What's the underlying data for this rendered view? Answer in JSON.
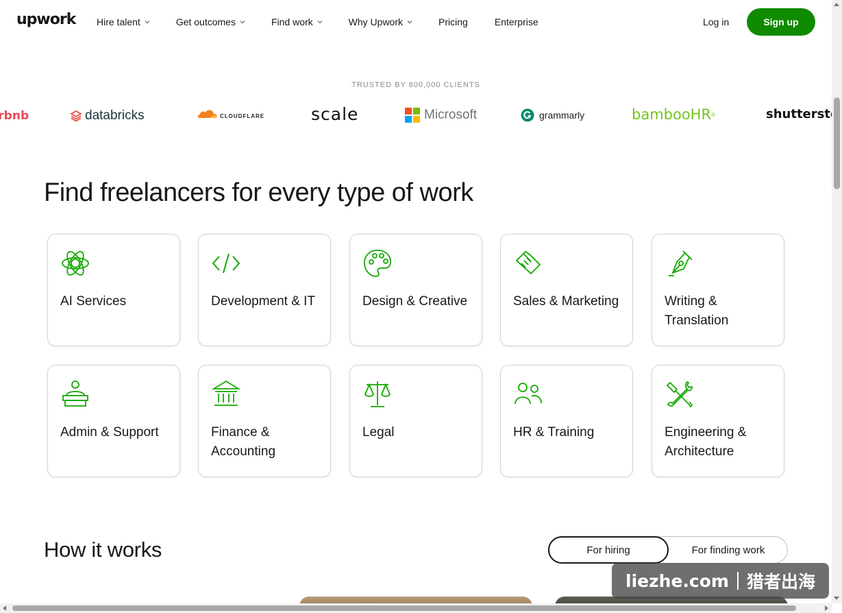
{
  "nav": {
    "logo": "upwork",
    "items": [
      {
        "label": "Hire talent",
        "dropdown": true
      },
      {
        "label": "Get outcomes",
        "dropdown": true
      },
      {
        "label": "Find work",
        "dropdown": true
      },
      {
        "label": "Why Upwork",
        "dropdown": true
      },
      {
        "label": "Pricing",
        "dropdown": false
      },
      {
        "label": "Enterprise",
        "dropdown": false
      }
    ],
    "login": "Log in",
    "signup": "Sign up"
  },
  "trusted": {
    "heading": "TRUSTED BY 800,000 CLIENTS",
    "brands": [
      "airbnb",
      "databricks",
      "CLOUDFLARE",
      "scale",
      "Microsoft",
      "grammarly",
      "bambooHR",
      "shutterstock"
    ]
  },
  "categories": {
    "heading": "Find freelancers for every type of work",
    "items": [
      {
        "label": "AI Services",
        "icon": "ai-flower-icon"
      },
      {
        "label": "Development & IT",
        "icon": "code-brackets-icon"
      },
      {
        "label": "Design & Creative",
        "icon": "palette-icon"
      },
      {
        "label": "Sales & Marketing",
        "icon": "handshake-icon"
      },
      {
        "label": "Writing & Translation",
        "icon": "pen-nib-icon"
      },
      {
        "label": "Admin & Support",
        "icon": "reception-desk-icon"
      },
      {
        "label": "Finance & Accounting",
        "icon": "bank-building-icon"
      },
      {
        "label": "Legal",
        "icon": "scales-icon"
      },
      {
        "label": "HR & Training",
        "icon": "people-icon"
      },
      {
        "label": "Engineering & Architecture",
        "icon": "tools-icon"
      }
    ]
  },
  "how": {
    "heading": "How it works",
    "tabs": {
      "active": "For hiring",
      "inactive": "For finding work"
    }
  },
  "watermark": {
    "left": "liezhe.com",
    "right": "猎者出海"
  },
  "colors": {
    "brand": "#108a00",
    "icon": "#14a800",
    "text": "#181818"
  }
}
